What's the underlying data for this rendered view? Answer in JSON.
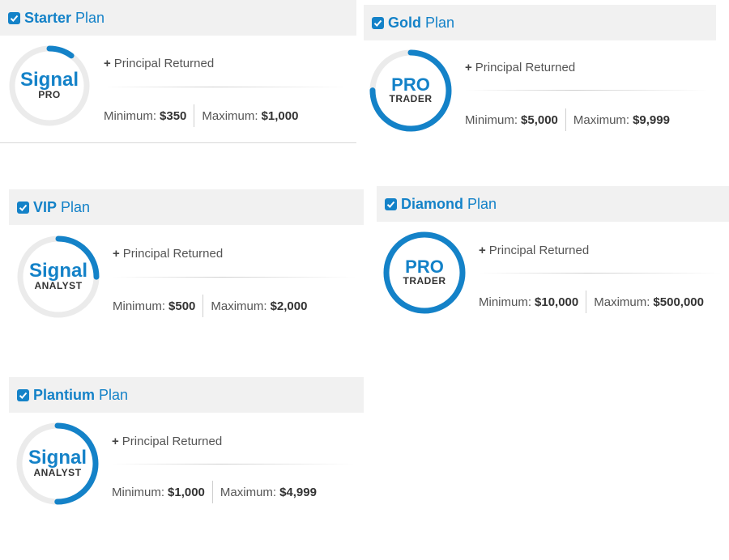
{
  "plans": [
    {
      "name": "Starter",
      "plan_word": "Plan",
      "badge_big": "Signal",
      "badge_small": "PRO",
      "feature": "Principal Returned",
      "minimum_label": "Minimum:",
      "minimum_value": "$350",
      "maximum_label": "Maximum:",
      "maximum_value": "$1,000",
      "ring_fill": 0.1
    },
    {
      "name": "Gold",
      "plan_word": "Plan",
      "badge_big": "PRO",
      "badge_small": "TRADER",
      "feature": "Principal Returned",
      "minimum_label": "Minimum:",
      "minimum_value": "$5,000",
      "maximum_label": "Maximum:",
      "maximum_value": "$9,999",
      "ring_fill": 0.75
    },
    {
      "name": "VIP",
      "plan_word": "Plan",
      "badge_big": "Signal",
      "badge_small": "ANALYST",
      "feature": "Principal Returned",
      "minimum_label": "Minimum:",
      "minimum_value": "$500",
      "maximum_label": "Maximum:",
      "maximum_value": "$2,000",
      "ring_fill": 0.25
    },
    {
      "name": "Diamond",
      "plan_word": "Plan",
      "badge_big": "PRO",
      "badge_small": "TRADER",
      "feature": "Principal Returned",
      "minimum_label": "Minimum:",
      "minimum_value": "$10,000",
      "maximum_label": "Maximum:",
      "maximum_value": "$500,000",
      "ring_fill": 1.0
    },
    {
      "name": "Plantium",
      "plan_word": "Plan",
      "badge_big": "Signal",
      "badge_small": "ANALYST",
      "feature": "Principal Returned",
      "minimum_label": "Minimum:",
      "minimum_value": "$1,000",
      "maximum_label": "Maximum:",
      "maximum_value": "$4,999",
      "ring_fill": 0.5
    }
  ],
  "colors": {
    "accent": "#1482c8",
    "ring_track": "#ebebeb",
    "header_bg": "#f1f1f1"
  }
}
